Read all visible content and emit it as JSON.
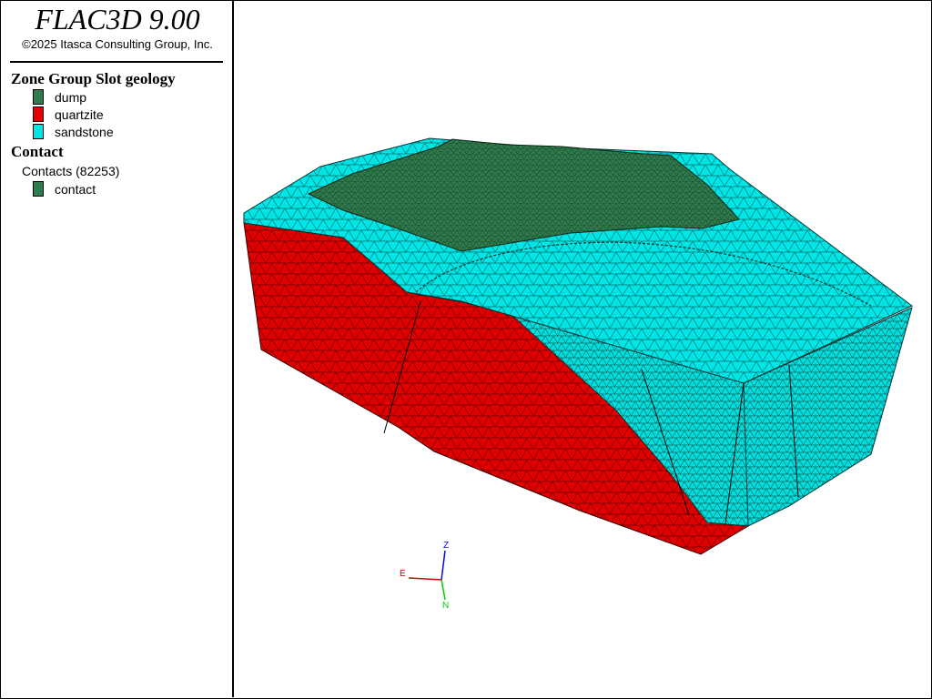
{
  "app": {
    "title": "FLAC3D 9.00",
    "copyright": "©2025 Itasca Consulting Group, Inc."
  },
  "legend": {
    "zone_group_title": "Zone Group Slot geology",
    "zone_groups": [
      {
        "label": "dump",
        "color": "#2e7d4f"
      },
      {
        "label": "quartzite",
        "color": "#e60000"
      },
      {
        "label": "sandstone",
        "color": "#00e5e5"
      }
    ],
    "contact_title": "Contact",
    "contacts_label": "Contacts (82253)",
    "contact_items": [
      {
        "label": "contact",
        "color": "#2e7d4f"
      }
    ]
  },
  "axes": {
    "z_label": "Z",
    "e_label": "E",
    "n_label": "N",
    "z_color": "#0000ff",
    "e_color": "#cc0000",
    "n_color": "#00cc00"
  }
}
